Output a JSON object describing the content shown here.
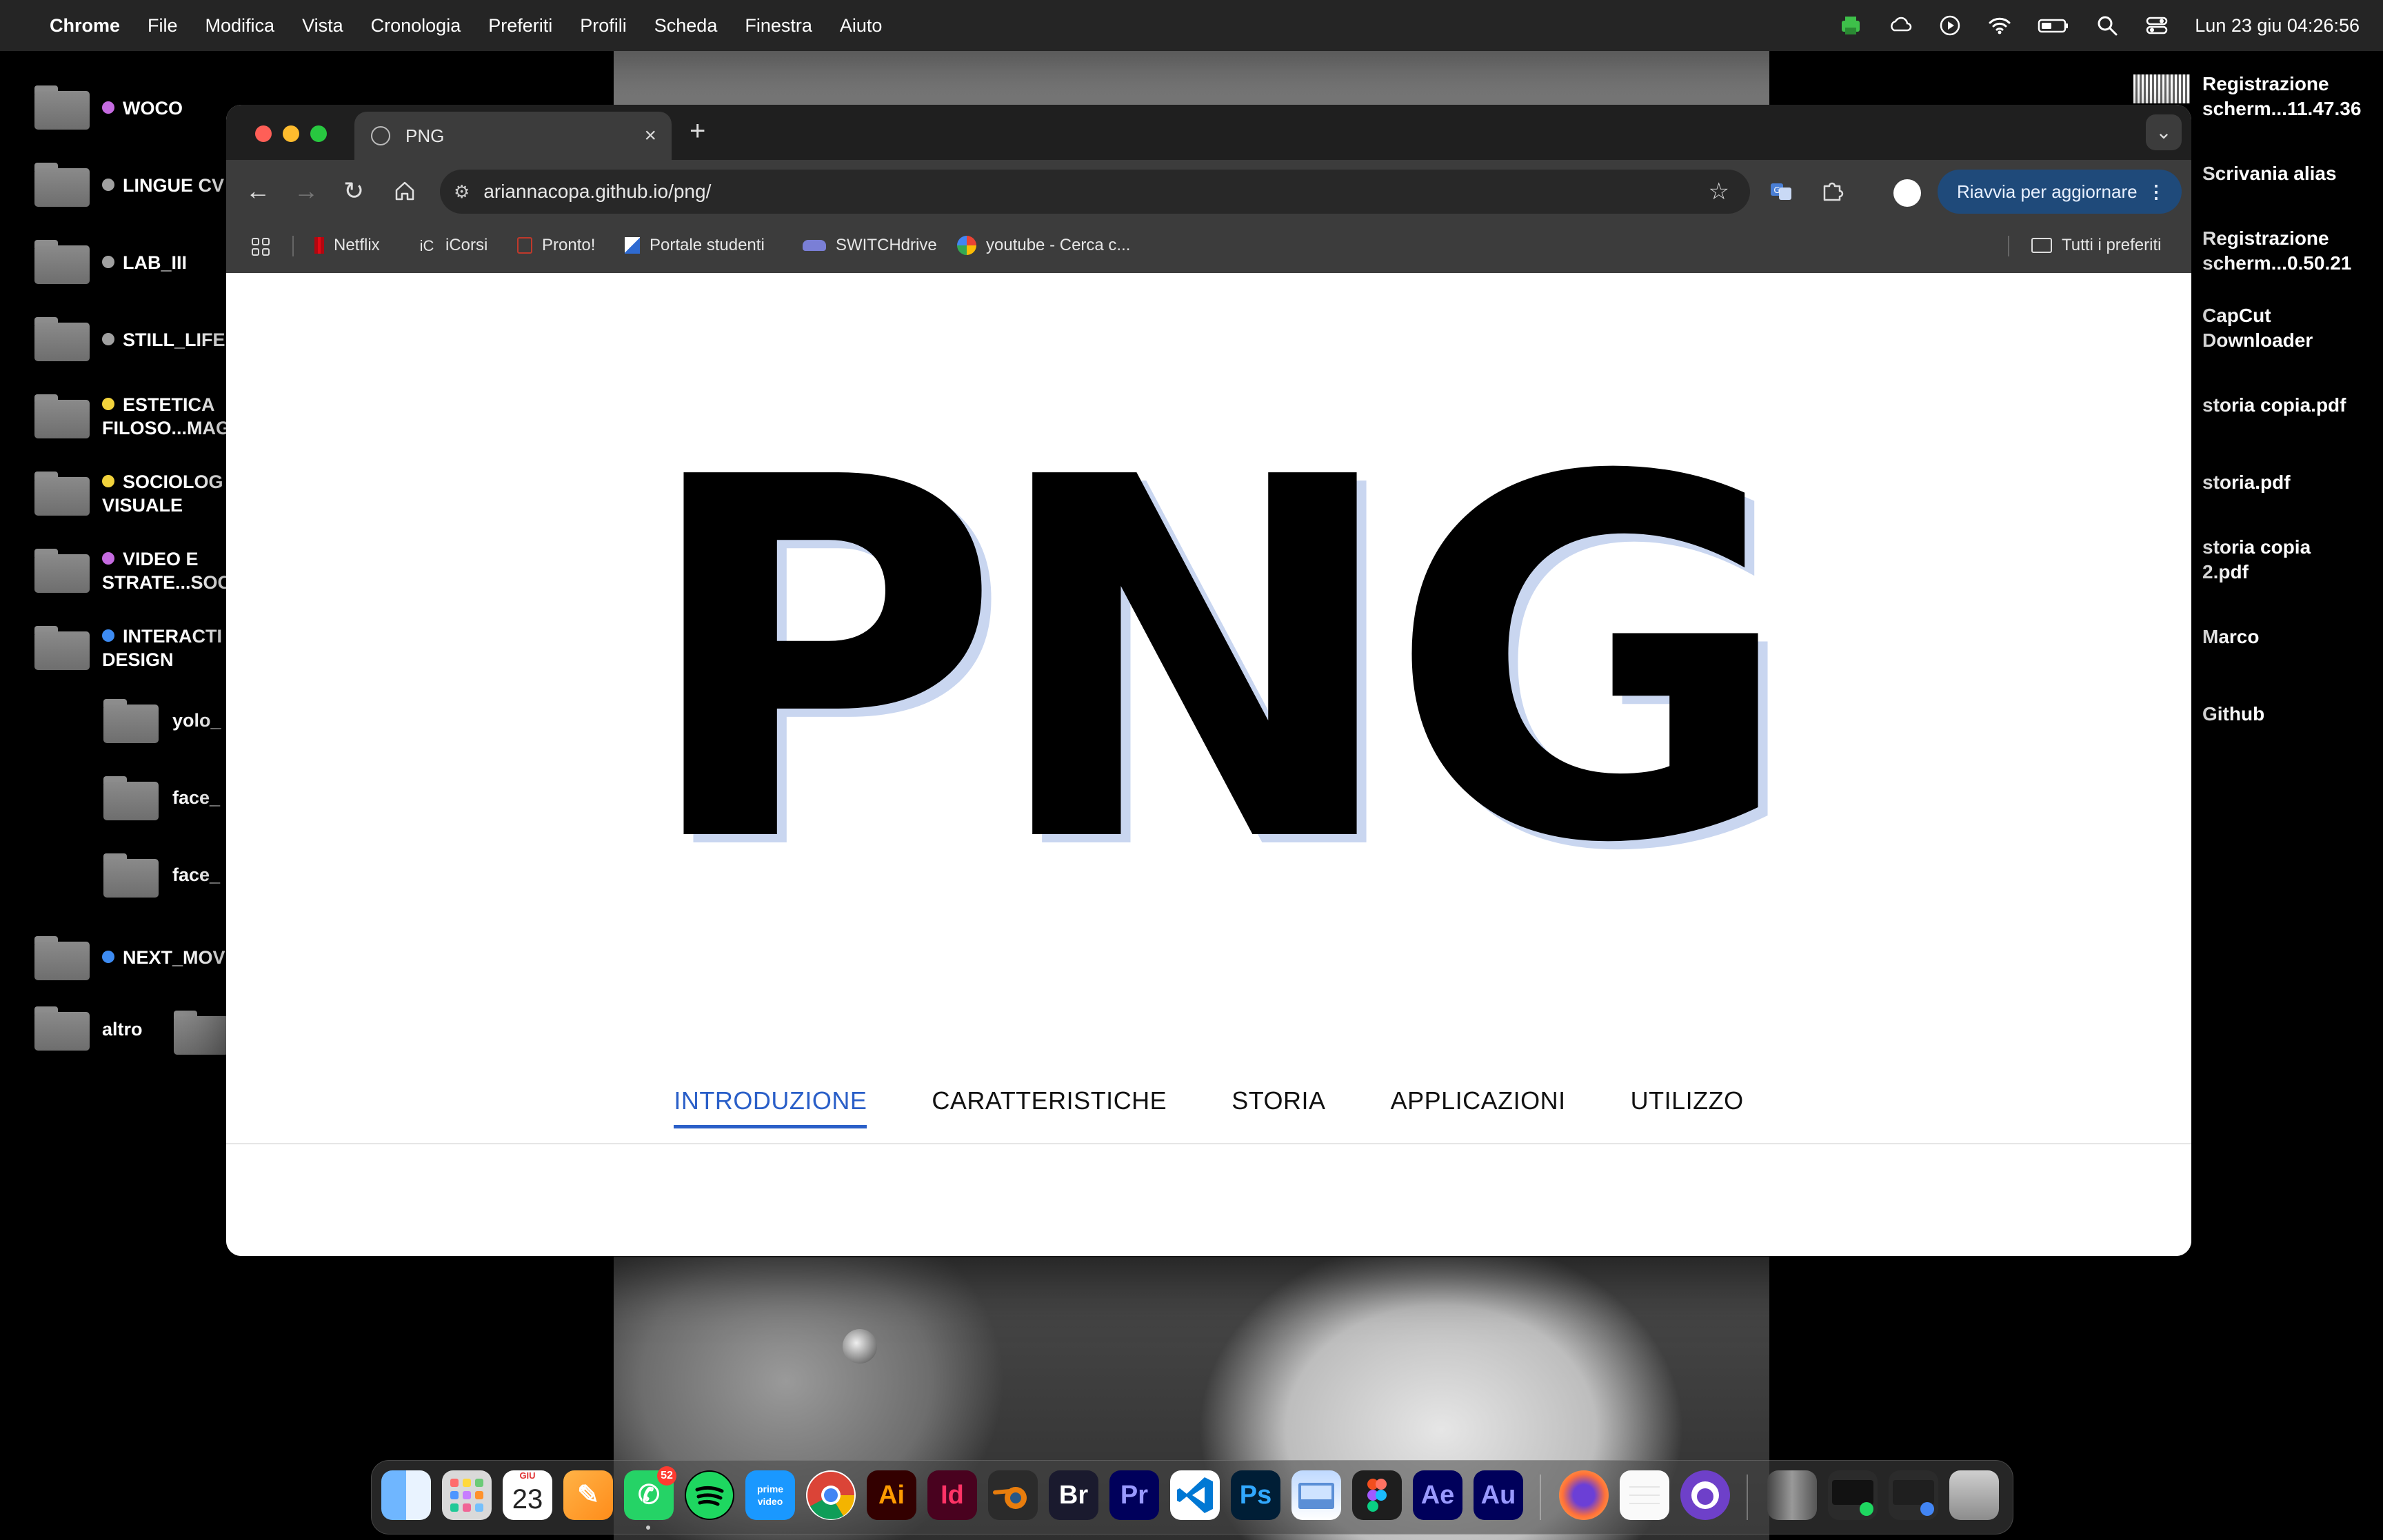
{
  "menubar": {
    "app": "Chrome",
    "items": [
      "File",
      "Modifica",
      "Vista",
      "Cronologia",
      "Preferiti",
      "Profili",
      "Scheda",
      "Finestra",
      "Aiuto"
    ],
    "datetime": "Lun 23 giu  04:26:56"
  },
  "desktop_left": [
    {
      "label1": "WOCO",
      "label2": "",
      "dot": "#c56be0"
    },
    {
      "label1": "LINGUE CV",
      "label2": "",
      "dot": "#a0a0a0"
    },
    {
      "label1": "LAB_III",
      "label2": "",
      "dot": "#a0a0a0"
    },
    {
      "label1": "STILL_LIFE",
      "label2": "",
      "dot": "#a0a0a0"
    },
    {
      "label1": "ESTETICA",
      "label2": "FILOSO...MAG",
      "dot": "#f2d33c"
    },
    {
      "label1": "SOCIOLOG",
      "label2": "VISUALE",
      "dot": "#f2d33c"
    },
    {
      "label1": "VIDEO E",
      "label2": "STRATE...SOC",
      "dot": "#c56be0"
    },
    {
      "label1": "INTERACTI",
      "label2": "DESIGN",
      "dot": "#3d8bf2"
    }
  ],
  "desktop_sub": [
    "yolo_",
    "face_",
    "face_"
  ],
  "desktop_left_more": [
    {
      "label1": "NEXT_MOV",
      "dot": "#3d8bf2"
    },
    {
      "label1": "altro",
      "dot": ""
    }
  ],
  "desktop_right": [
    {
      "line1": "Registrazione",
      "line2": "scherm...11.47.36"
    },
    {
      "line1": "Scrivania alias",
      "line2": ""
    },
    {
      "line1": "Registrazione",
      "line2": "scherm...0.50.21"
    },
    {
      "line1": "CapCut",
      "line2": "Downloader"
    },
    {
      "line1": "storia copia.pdf",
      "line2": ""
    },
    {
      "line1": "storia.pdf",
      "line2": ""
    },
    {
      "line1": "storia copia",
      "line2": "2.pdf"
    },
    {
      "line1": "Marco",
      "line2": ""
    },
    {
      "line1": "Github",
      "line2": ""
    }
  ],
  "browser": {
    "tab_title": "PNG",
    "url": "ariannacopa.github.io/png/",
    "update_button": "Riavvia per aggiornare",
    "bookmarks": [
      "Netflix",
      "iCorsi",
      "Pronto!",
      "Portale studenti",
      "SWITCHdrive",
      "youtube - Cerca c..."
    ],
    "all_bookmarks": "Tutti i preferiti"
  },
  "page": {
    "hero": "PNG",
    "nav": [
      "INTRODUZIONE",
      "CARATTERISTICHE",
      "STORIA",
      "APPLICAZIONI",
      "UTILIZZO"
    ],
    "active_nav": "INTRODUZIONE"
  },
  "dock": {
    "calendar_month": "GIU",
    "calendar_day": "23",
    "whatsapp_badge": "52",
    "labels": [
      "Ai",
      "Id",
      "Br",
      "Pr",
      "Ps",
      "Ae",
      "Au"
    ]
  },
  "colors": {
    "accent": "#2a5fc8",
    "hero_shadow": "#c9d6f0",
    "update_button": "#1f4a7a"
  }
}
